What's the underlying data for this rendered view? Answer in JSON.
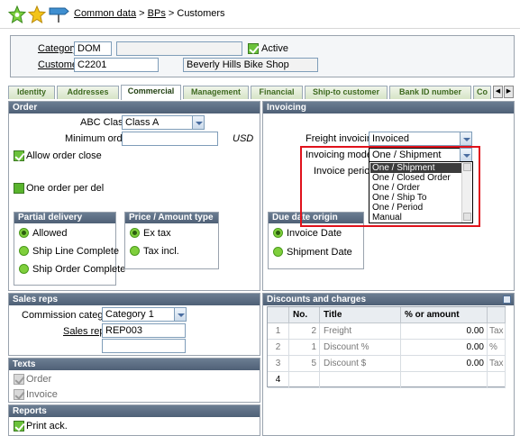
{
  "breadcrumb": {
    "part1": "Common data",
    "sep1": " > ",
    "part2": "BPs",
    "sep2": " > ",
    "part3": "Customers"
  },
  "icons": {
    "home": "home-icon",
    "favorite": "star-icon",
    "signpost": "signpost-icon"
  },
  "header": {
    "category_label": "Category",
    "category_value": "DOM",
    "category_desc": "",
    "active_label": "Active",
    "customer_label": "Customer",
    "customer_value": "C2201",
    "customer_name": "Beverly Hills Bike Shop"
  },
  "tabs": [
    "Identity",
    "Addresses",
    "Commercial",
    "Management",
    "Financial",
    "Ship-to customer",
    "Bank ID number",
    "Co"
  ],
  "order": {
    "title": "Order",
    "abc_label": "ABC Class",
    "abc_value": "Class A",
    "min_order_label": "Minimum order",
    "min_order_value": "",
    "currency": "USD",
    "allow_close_label": "Allow order close",
    "one_order_label": "One order per del",
    "partial": {
      "title": "Partial delivery",
      "options": [
        "Allowed",
        "Ship Line Complete",
        "Ship Order Complete"
      ]
    },
    "price": {
      "title": "Price / Amount type",
      "options": [
        "Ex tax",
        "Tax incl."
      ]
    }
  },
  "invoicing": {
    "title": "Invoicing",
    "freight_label": "Freight invoicing",
    "freight_value": "Invoiced",
    "mode_label": "Invoicing mode",
    "mode_value": "One / Shipment",
    "period_label": "Invoice period",
    "dropdown_options": [
      "One / Shipment",
      "One / Closed Order",
      "One / Order",
      "One / Ship To",
      "One / Period",
      "Manual"
    ],
    "due": {
      "title": "Due date origin",
      "options": [
        "Invoice Date",
        "Shipment Date"
      ]
    }
  },
  "sales": {
    "title": "Sales reps",
    "commission_label": "Commission category",
    "commission_value": "Category 1",
    "rep_label": "Sales rep",
    "rep_value": "REP003",
    "rep_value2": ""
  },
  "texts": {
    "title": "Texts",
    "order_label": "Order",
    "invoice_label": "Invoice"
  },
  "reports": {
    "title": "Reports",
    "print_label": "Print ack."
  },
  "discounts": {
    "title": "Discounts and charges",
    "columns": [
      "No.",
      "Title",
      "% or amount"
    ],
    "rows": [
      {
        "idx": "1",
        "no": "2",
        "title": "Freight",
        "amount": "0.00",
        "unit": "Tax"
      },
      {
        "idx": "2",
        "no": "1",
        "title": "Discount %",
        "amount": "0.00",
        "unit": "%"
      },
      {
        "idx": "3",
        "no": "5",
        "title": "Discount $",
        "amount": "0.00",
        "unit": "Tax"
      },
      {
        "idx": "4",
        "no": "",
        "title": "",
        "amount": "",
        "unit": ""
      }
    ]
  }
}
